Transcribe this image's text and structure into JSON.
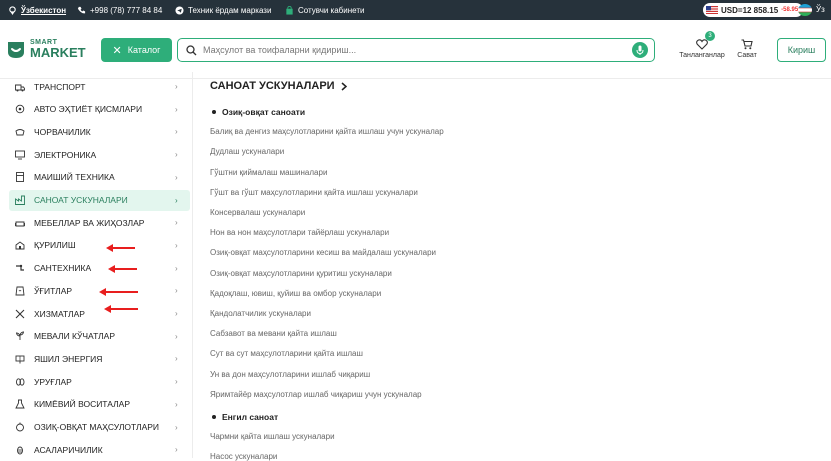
{
  "topbar": {
    "region": "Ўзбекистон",
    "phone": "+998 (78) 777 84 84",
    "support": "Техник ёрдам маркази",
    "cabinet": "Сотувчи кабинети",
    "currency": {
      "label": "USD=12 858.15",
      "delta": "-58.95",
      "delta_color": "#e33333"
    },
    "lang": "Ўз"
  },
  "header": {
    "logo_small": "SMART",
    "logo_big": "MARKET",
    "catalog_label": "Каталог",
    "search_placeholder": "Маҳсулот ва тоифаларни қидириш...",
    "favorites_label": "Танланганлар",
    "favorites_count": "3",
    "cart_label": "Сават",
    "login_label": "Кириш",
    "accent": "#2eae7a"
  },
  "sidebar": {
    "items": [
      {
        "label": "ТРАНСПОРТ",
        "icon": "truck-icon"
      },
      {
        "label": "АВТО ЭҲТИЁТ ҚИСМЛАРИ",
        "icon": "car-part-icon"
      },
      {
        "label": "ЧОРВАЧИЛИК",
        "icon": "livestock-icon"
      },
      {
        "label": "ЭЛЕКТРОНИКА",
        "icon": "monitor-icon"
      },
      {
        "label": "МАИШИЙ ТЕХНИКА",
        "icon": "appliance-icon"
      },
      {
        "label": "САНОАТ УСКУНАЛАРИ",
        "icon": "factory-icon"
      },
      {
        "label": "МЕБЕЛЛАР ВА ЖИҲОЗЛАР",
        "icon": "sofa-icon"
      },
      {
        "label": "ҚУРИЛИШ",
        "icon": "construction-icon"
      },
      {
        "label": "САНТЕХНИКА",
        "icon": "plumbing-icon"
      },
      {
        "label": "ЎҒИТЛАР",
        "icon": "fertilizer-icon"
      },
      {
        "label": "ХИЗМАТЛАР",
        "icon": "tools-icon"
      },
      {
        "label": "МЕВАЛИ КЎЧАТЛАР",
        "icon": "seedling-icon"
      },
      {
        "label": "ЯШИЛ ЭНЕРГИЯ",
        "icon": "solar-icon"
      },
      {
        "label": "УРУҒЛАР",
        "icon": "seeds-icon"
      },
      {
        "label": "КИМЁВИЙ ВОСИТАЛАР",
        "icon": "chemical-icon"
      },
      {
        "label": "ОЗИҚ-ОВҚАТ МАҲСУЛОТЛАРИ",
        "icon": "food-icon"
      },
      {
        "label": "АСАЛАРИЧИЛИК",
        "icon": "bee-icon"
      }
    ],
    "active_index": 5
  },
  "main": {
    "title": "САНОАТ УСКУНАЛАРИ",
    "sections": [
      {
        "title": "Озиқ-овқат саноати",
        "items": [
          "Балиқ ва денгиз маҳсулотларини қайта ишлаш учун ускуналар",
          "Дудлаш ускуналари",
          "Гўштни қиймалаш машиналари",
          "Гўшт ва гўшт маҳсулотларини қайта ишлаш ускуналари",
          "Консервалаш ускуналари",
          "Нон ва нон маҳсулотлари тайёрлаш ускуналари",
          "Озиқ-овқат маҳсулотларини кесиш ва майдалаш ускуналари",
          "Озиқ-овқат маҳсулотларини қуритиш ускуналари",
          "Қадоқлаш, ювиш, қуйиш ва омбор ускуналари",
          "Қандолатчилик ускуналари",
          "Сабзавот ва мевани қайта ишлаш",
          "Сут ва сут маҳсулотларини қайта ишлаш",
          "Ун ва дон маҳсулотларини ишлаб чиқариш",
          "Яримтайёр маҳсулотлар ишлаб чиқариш учун ускуналар"
        ]
      },
      {
        "title": "Енгил саноат",
        "items": [
          "Чармни қайта ишлаш ускуналари",
          "Насос ускуналари"
        ]
      }
    ]
  }
}
